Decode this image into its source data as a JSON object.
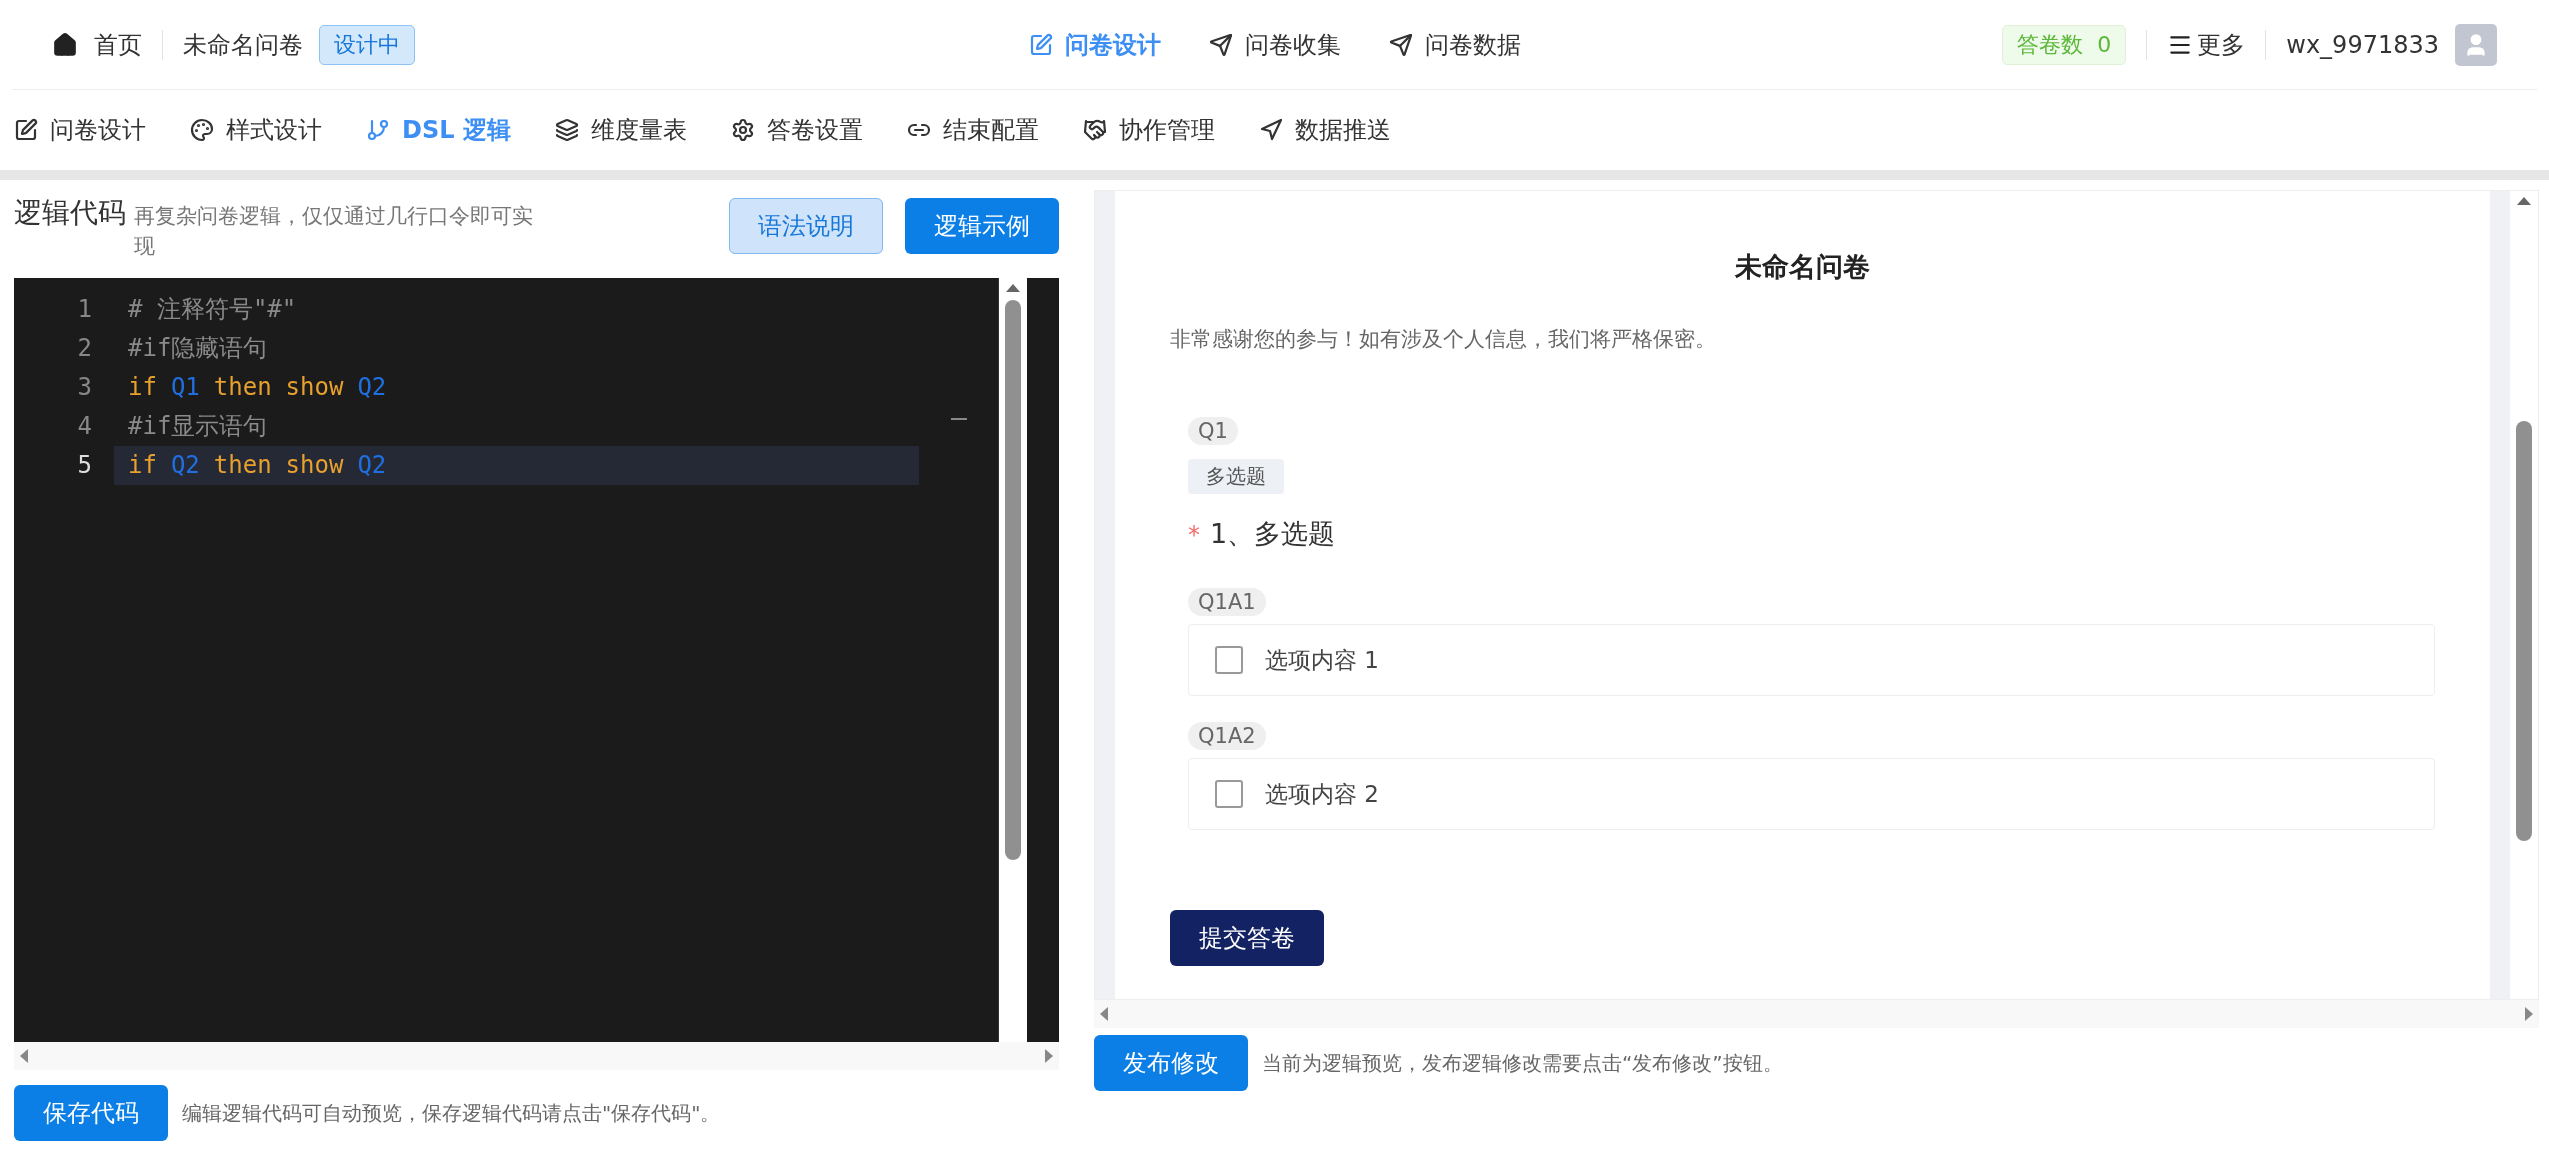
{
  "header": {
    "home": "首页",
    "survey_name": "未命名问卷",
    "status_badge": "设计中",
    "main_tabs": [
      {
        "label": "问卷设计",
        "selected": true
      },
      {
        "label": "问卷收集",
        "selected": false
      },
      {
        "label": "问卷数据",
        "selected": false
      }
    ],
    "answer_count_label": "答卷数",
    "answer_count": "0",
    "more": "更多",
    "username": "wx_9971833"
  },
  "sub_tabs": [
    {
      "label": "问卷设计",
      "selected": false
    },
    {
      "label": "样式设计",
      "selected": false
    },
    {
      "label": "DSL 逻辑",
      "selected": true
    },
    {
      "label": "维度量表",
      "selected": false
    },
    {
      "label": "答卷设置",
      "selected": false
    },
    {
      "label": "结束配置",
      "selected": false
    },
    {
      "label": "协作管理",
      "selected": false
    },
    {
      "label": "数据推送",
      "selected": false
    }
  ],
  "editor": {
    "title": "逻辑代码",
    "subtitle": "再复杂问卷逻辑，仅仅通过几行口令即可实现",
    "buttons": [
      {
        "label": "语法说明",
        "kind": "light"
      },
      {
        "label": "逻辑示例",
        "kind": "primary"
      }
    ],
    "lines": [
      {
        "number": "1",
        "active": false,
        "tokens": [
          {
            "kind": "comment",
            "text": "# 注释符号\"#\""
          }
        ]
      },
      {
        "number": "2",
        "active": false,
        "tokens": [
          {
            "kind": "comment",
            "text": "#if隐藏语句"
          }
        ]
      },
      {
        "number": "3",
        "active": false,
        "tokens": [
          {
            "kind": "keyword",
            "text": "if"
          },
          {
            "kind": "ident",
            "text": "Q1"
          },
          {
            "kind": "keyword",
            "text": "then"
          },
          {
            "kind": "keyword",
            "text": "show"
          },
          {
            "kind": "ident",
            "text": "Q2"
          }
        ]
      },
      {
        "number": "4",
        "active": false,
        "tokens": [
          {
            "kind": "comment",
            "text": "#if显示语句"
          }
        ]
      },
      {
        "number": "5",
        "active": true,
        "tokens": [
          {
            "kind": "keyword",
            "text": "if"
          },
          {
            "kind": "ident",
            "text": "Q2"
          },
          {
            "kind": "keyword",
            "text": "then"
          },
          {
            "kind": "keyword",
            "text": "show"
          },
          {
            "kind": "ident",
            "text": "Q2"
          }
        ]
      }
    ],
    "save_button": "保存代码",
    "save_note": "编辑逻辑代码可自动预览，保存逻辑代码请点击\"保存代码\"。"
  },
  "preview": {
    "title": "未命名问卷",
    "intro": "非常感谢您的参与！如有涉及个人信息，我们将严格保密。",
    "question": {
      "id": "Q1",
      "type": "多选题",
      "required_mark": "*",
      "title": "1、多选题",
      "options": [
        {
          "id": "Q1A1",
          "label": "选项内容 1",
          "checked": false
        },
        {
          "id": "Q1A2",
          "label": "选项内容 2",
          "checked": false
        }
      ]
    },
    "submit": "提交答卷",
    "publish_button": "发布修改",
    "publish_note": "当前为逻辑预览，发布逻辑修改需要点击“发布修改”按钮。"
  }
}
